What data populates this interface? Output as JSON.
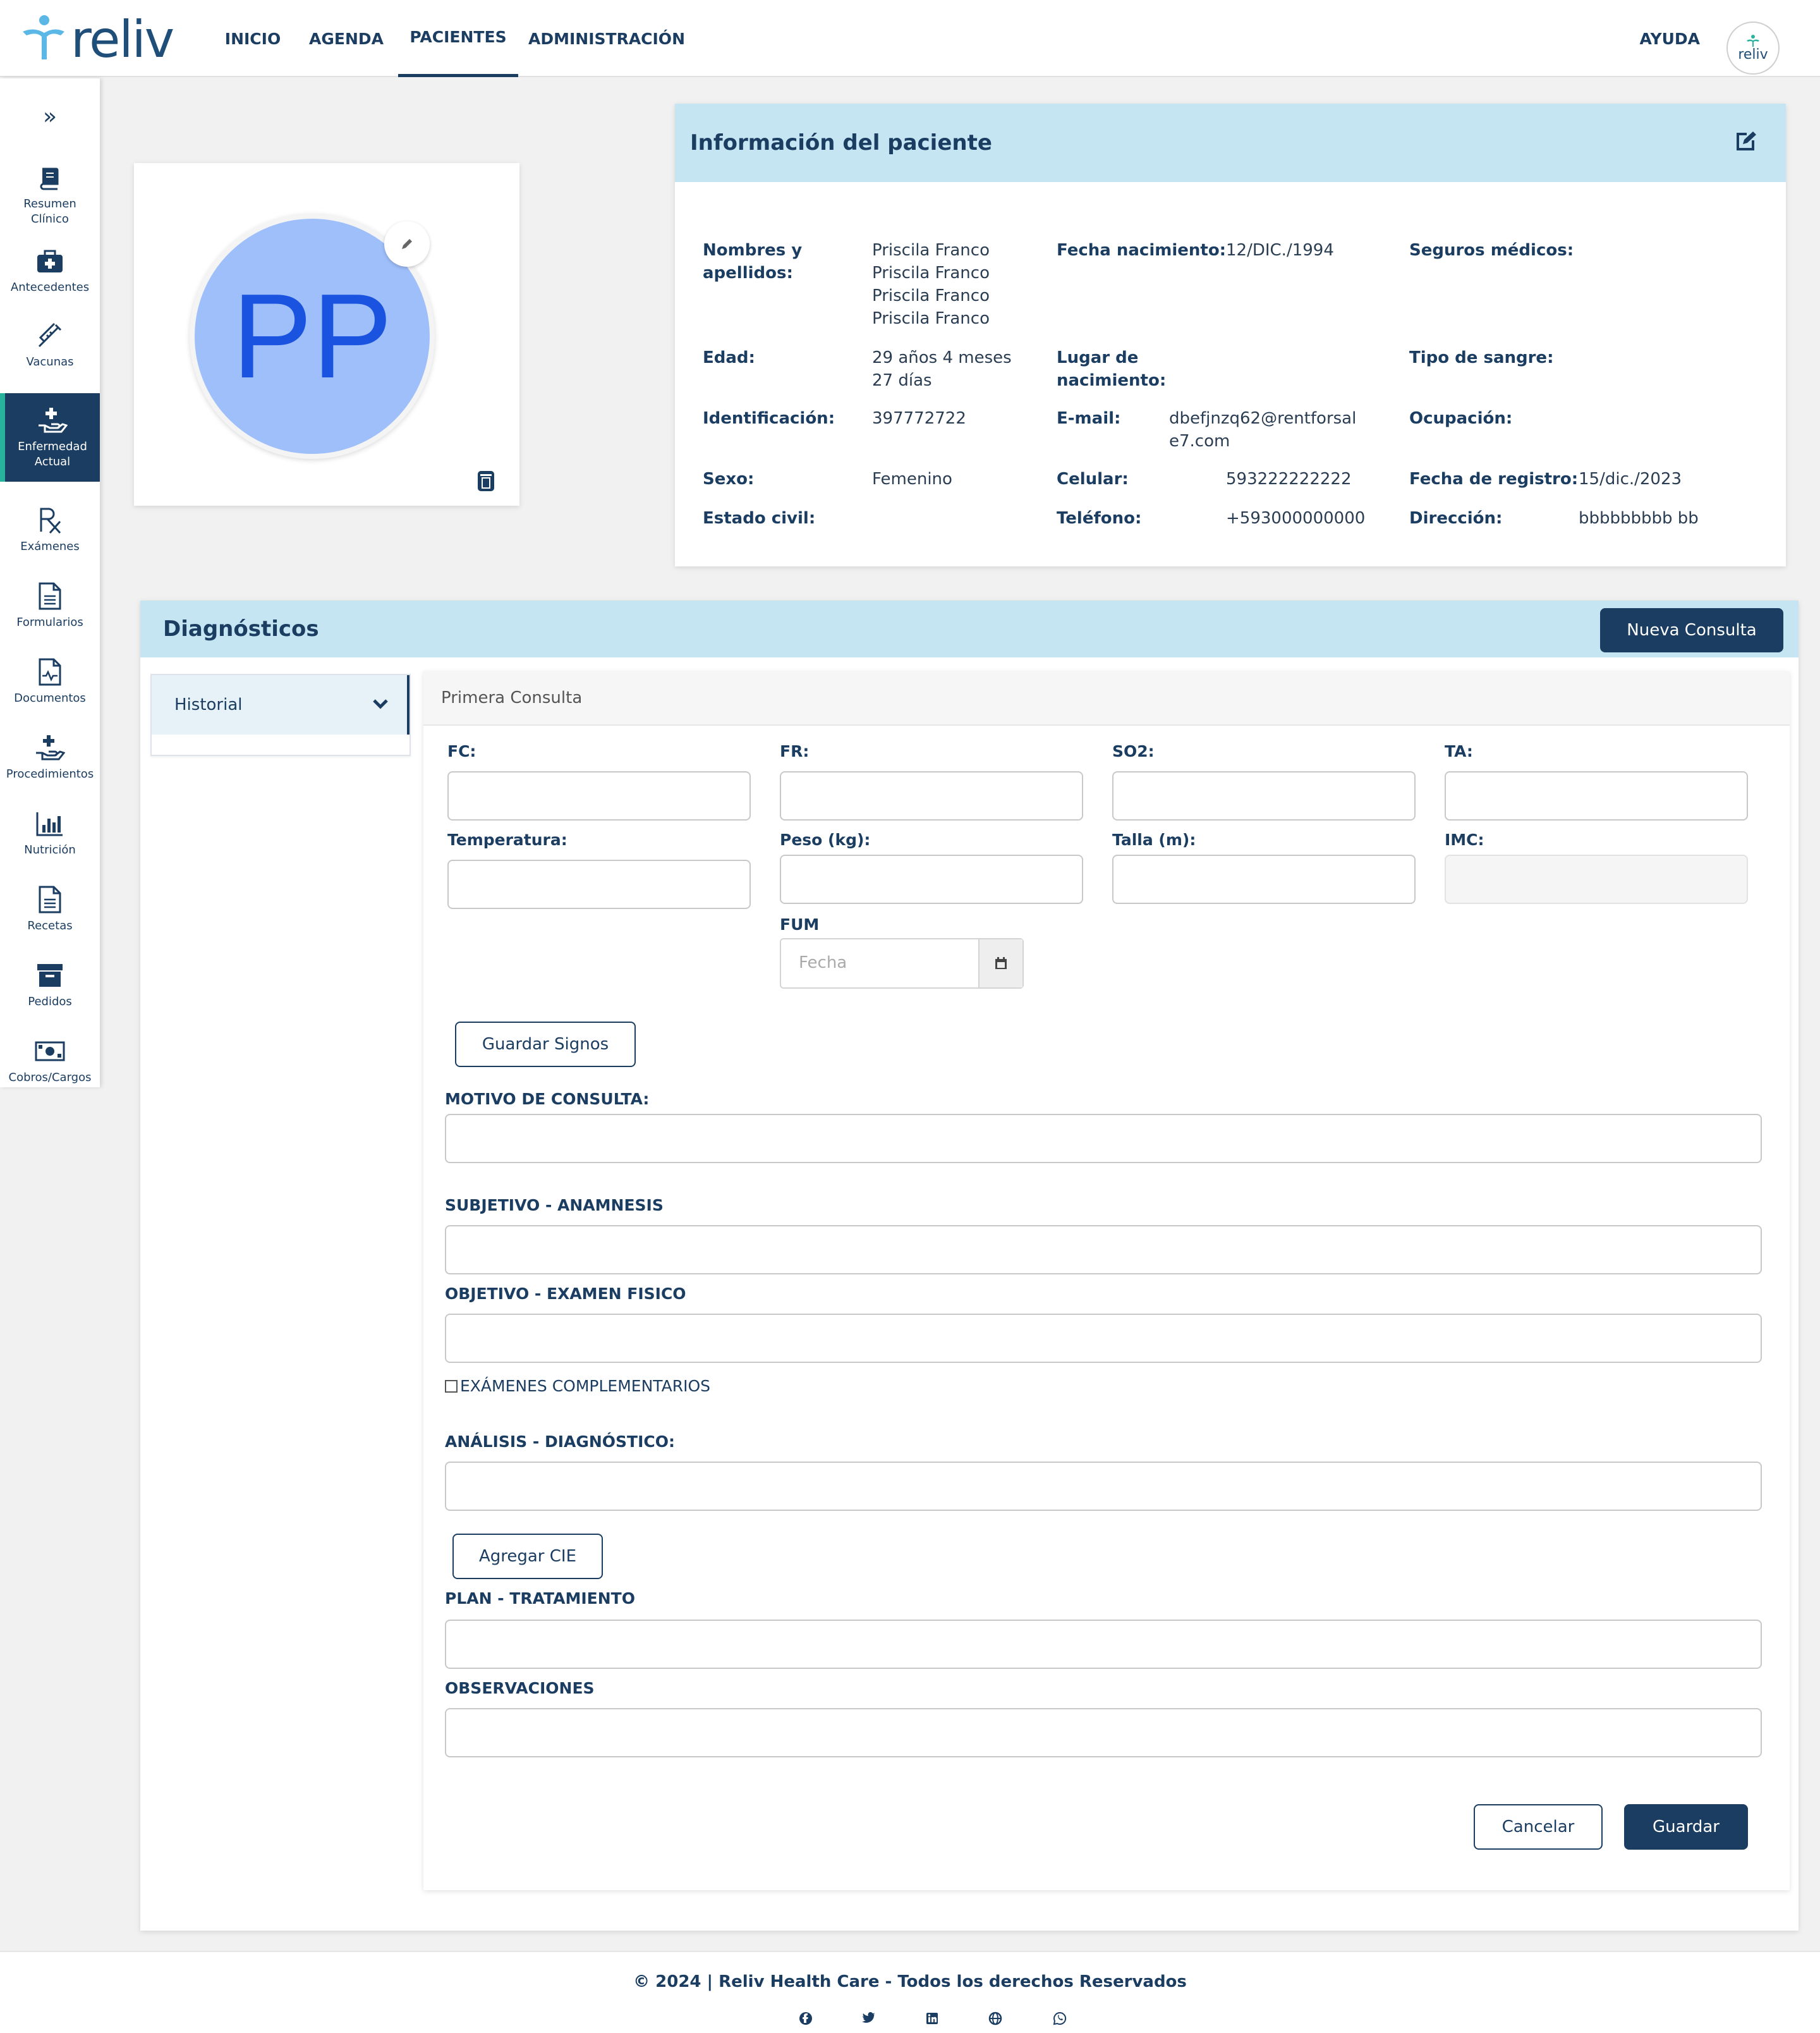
{
  "brand": {
    "name": "reliv",
    "color": "#1b3d61",
    "accent": "#27b39b"
  },
  "nav": {
    "items": [
      "INICIO",
      "AGENDA",
      "PACIENTES",
      "ADMINISTRACIÓN"
    ],
    "active": "PACIENTES",
    "help": "AYUDA"
  },
  "user_avatar": {
    "label": "reliv"
  },
  "sidebar": {
    "toggle_icon": "double-chevron-right-icon",
    "items": [
      {
        "label": "Resumen Clínico",
        "icon": "book-icon"
      },
      {
        "label": "Antecedentes",
        "icon": "first-aid-kit-icon"
      },
      {
        "label": "Vacunas",
        "icon": "syringe-icon"
      },
      {
        "label": "Enfermedad Actual",
        "icon": "hand-holding-medical-icon",
        "active": true
      },
      {
        "label": "Exámenes",
        "icon": "prescription-icon"
      },
      {
        "label": "Formularios",
        "icon": "document-icon"
      },
      {
        "label": "Documentos",
        "icon": "file-medical-icon"
      },
      {
        "label": "Procedimientos",
        "icon": "hand-holding-medical-icon"
      },
      {
        "label": "Nutrición",
        "icon": "bar-chart-icon"
      },
      {
        "label": "Recetas",
        "icon": "document-icon"
      },
      {
        "label": "Pedidos",
        "icon": "archive-box-icon"
      },
      {
        "label": "Cobros/Cargos",
        "icon": "money-bill-icon"
      }
    ]
  },
  "photo": {
    "initials": "PP",
    "bg_color": "#9fbffb"
  },
  "patient": {
    "title": "Información del paciente",
    "labels": {
      "names": "Nombres y apellidos:",
      "birthdate": "Fecha nacimiento:",
      "insurance": "Seguros médicos:",
      "age": "Edad:",
      "birthplace": "Lugar de nacimiento:",
      "blood": "Tipo de sangre:",
      "id": "Identificación:",
      "email": "E-mail:",
      "occupation": "Ocupación:",
      "sex": "Sexo:",
      "mobile": "Celular:",
      "registered": "Fecha de registro:",
      "civil": "Estado civil:",
      "phone": "Teléfono:",
      "address": "Dirección:"
    },
    "values": {
      "names": [
        "Priscila Franco",
        "Priscila Franco",
        "Priscila Franco",
        "Priscila Franco"
      ],
      "birthdate": "12/DIC./1994",
      "age": [
        "29 años 4 meses",
        "27 días"
      ],
      "id": "397772722",
      "email": [
        "dbefjnzq62@rentforsal",
        "e7.com"
      ],
      "sex": "Femenino",
      "mobile": "593222222222",
      "registered": "15/dic./2023",
      "phone": "+593000000000",
      "address": "bbbbbbbbb bb"
    }
  },
  "diagnostics": {
    "title": "Diagnósticos",
    "new_button": "Nueva Consulta",
    "history_label": "Historial",
    "consult_title": "Primera Consulta",
    "vitals": {
      "fc": "FC:",
      "fr": "FR:",
      "so2": "SO2:",
      "ta": "TA:",
      "temp": "Temperatura:",
      "weight": "Peso (kg):",
      "height": "Talla (m):",
      "imc": "IMC:",
      "fum": "FUM"
    },
    "fum_placeholder": "Fecha",
    "save_vitals": "Guardar Signos",
    "motivo": "MOTIVO DE CONSULTA:",
    "subjetivo": "SUBJETIVO - ANAMNESIS",
    "objetivo": "OBJETIVO - EXAMEN FISICO",
    "complementarios": "EXÁMENES COMPLEMENTARIOS",
    "analisis": "ANÁLISIS - DIAGNÓSTICO:",
    "add_cie": "Agregar CIE",
    "plan": "PLAN - TRATAMIENTO",
    "observaciones": "OBSERVACIONES",
    "cancel": "Cancelar",
    "save": "Guardar"
  },
  "footer": {
    "copyright": "© 2024 | Reliv Health Care - Todos los derechos Reservados",
    "social_icons": [
      "facebook-icon",
      "twitter-icon",
      "linkedin-icon",
      "globe-icon",
      "whatsapp-icon"
    ]
  }
}
